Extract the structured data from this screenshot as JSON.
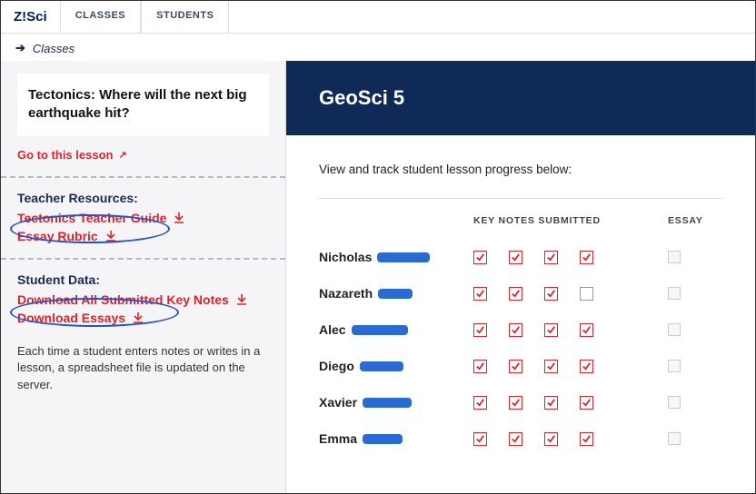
{
  "logo": "Z!Sci",
  "tabs": {
    "classes": "CLASSES",
    "students": "STUDENTS"
  },
  "breadcrumb": {
    "item": "Classes"
  },
  "lesson": {
    "title": "Tectonics: Where will the next big earthquake hit?",
    "goto": "Go to this lesson"
  },
  "teacher_resources": {
    "label": "Teacher Resources:",
    "guide": "Tectonics Teacher Guide",
    "rubric": "Essay Rubric"
  },
  "student_data": {
    "label": "Student Data:",
    "download_notes": "Download All Submitted Key Notes",
    "download_essays": "Download Essays"
  },
  "note": "Each time a student enters notes or writes in a lesson, a spreadsheet file is updated on the server.",
  "class": {
    "title": "GeoSci 5",
    "instruction": "View and track student lesson progress below:"
  },
  "headers": {
    "keynotes": "KEY NOTES SUBMITTED",
    "essay": "ESSAY"
  },
  "students": [
    {
      "name": "Nicholas",
      "checks": [
        true,
        true,
        true,
        true
      ],
      "essay": false
    },
    {
      "name": "Nazareth",
      "checks": [
        true,
        true,
        true,
        false
      ],
      "essay": false
    },
    {
      "name": "Alec",
      "checks": [
        true,
        true,
        true,
        true
      ],
      "essay": false
    },
    {
      "name": "Diego",
      "checks": [
        true,
        true,
        true,
        true
      ],
      "essay": false
    },
    {
      "name": "Xavier",
      "checks": [
        true,
        true,
        true,
        true
      ],
      "essay": false
    },
    {
      "name": "Emma",
      "checks": [
        true,
        true,
        true,
        true
      ],
      "essay": false
    }
  ],
  "redact_widths": [
    58,
    38,
    62,
    48,
    54,
    44
  ]
}
